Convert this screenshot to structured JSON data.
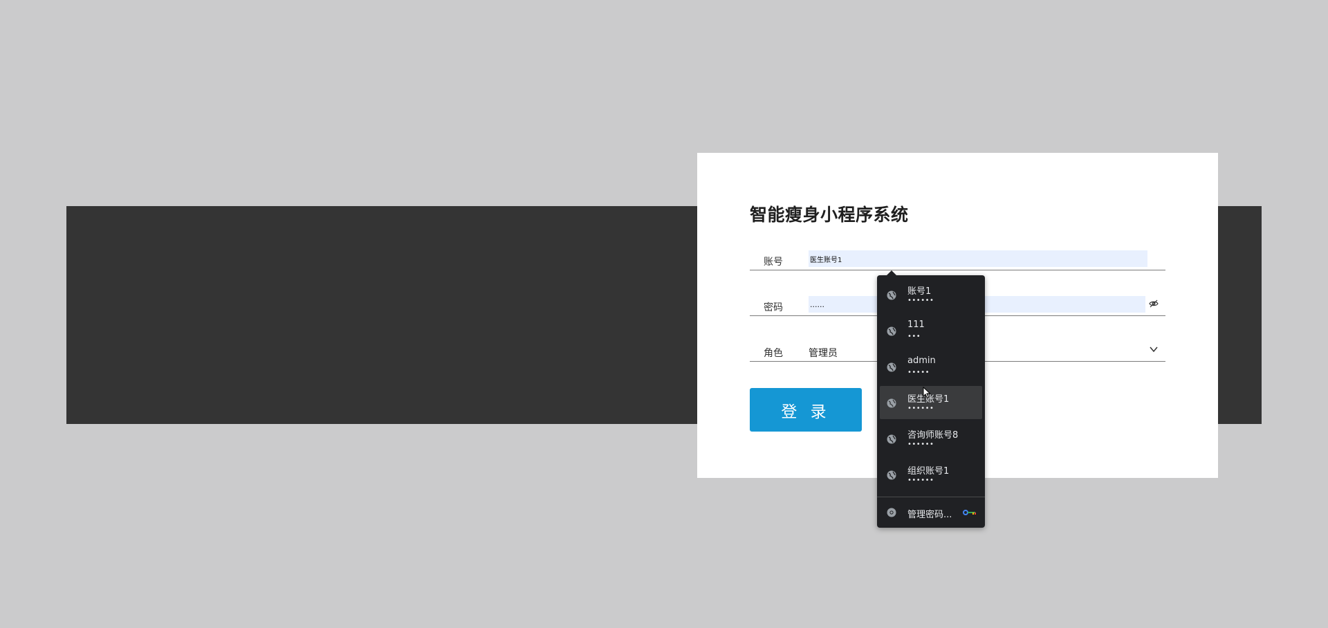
{
  "login": {
    "title": "智能瘦身小程序系统",
    "account_label": "账号",
    "account_value": "医生账号1",
    "password_label": "密码",
    "password_value": "......",
    "role_label": "角色",
    "role_value": "管理员",
    "login_button": "登 录"
  },
  "autofill": {
    "items": [
      {
        "username": "账号1",
        "password_mask": "••••••"
      },
      {
        "username": "111",
        "password_mask": "•••"
      },
      {
        "username": "admin",
        "password_mask": "•••••"
      },
      {
        "username": "医生账号1",
        "password_mask": "••••••"
      },
      {
        "username": "咨询师账号8",
        "password_mask": "••••••"
      },
      {
        "username": "组织账号1",
        "password_mask": "••••••"
      }
    ],
    "manage_label": "管理密码..."
  },
  "icons": {
    "credential": "globe-icon",
    "manage": "chrome-icon",
    "key": "key-icon",
    "password_toggle": "eye-slash-icon",
    "role_dropdown": "chevron-down-icon"
  },
  "colors": {
    "accent": "#1597d4",
    "autofill_bg": "#202124",
    "autofill_fill": "#e8f0fe"
  }
}
